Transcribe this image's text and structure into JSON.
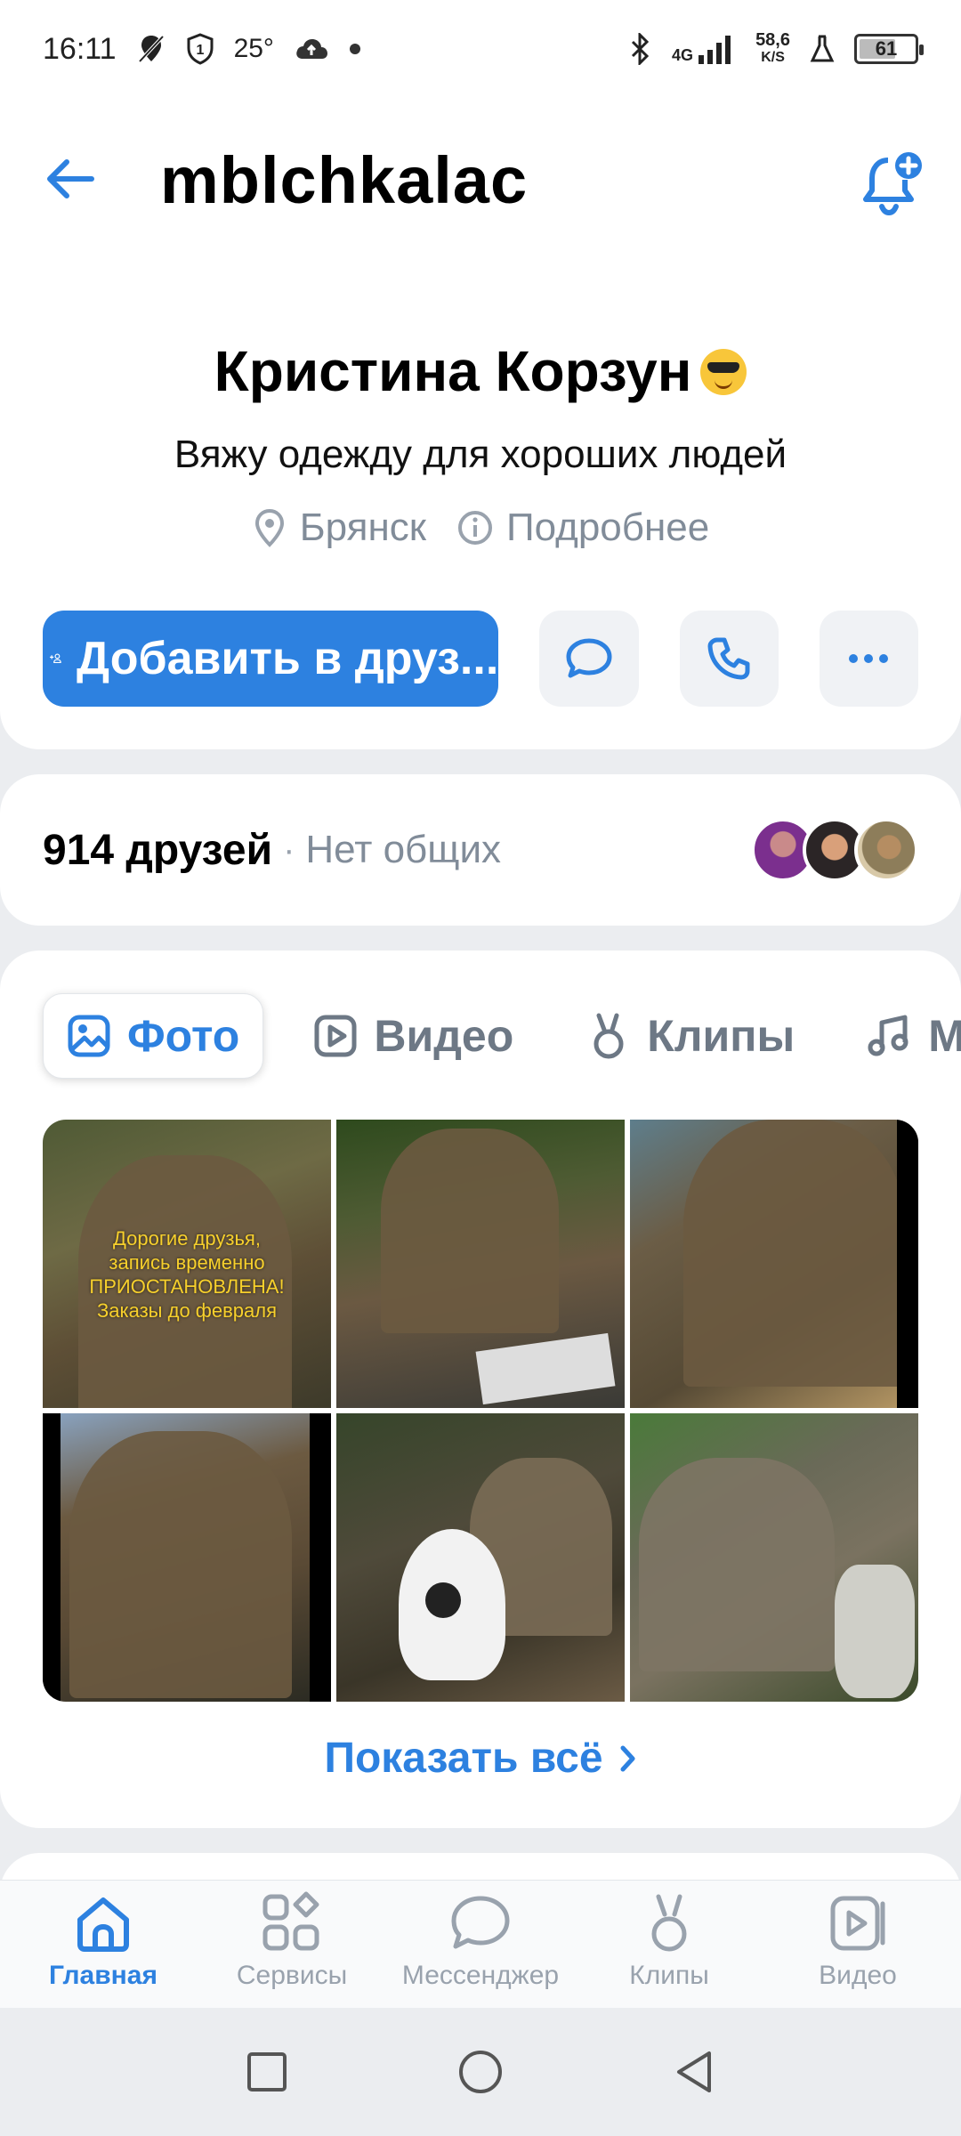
{
  "status_bar": {
    "time": "16:11",
    "temperature": "25°",
    "network_type": "4G",
    "speed_value": "58,6",
    "speed_unit": "K/S",
    "battery": "61"
  },
  "header": {
    "title": "mblchkalac"
  },
  "profile": {
    "name": "Кристина Корзун",
    "status": "Вяжу одежду для хороших людей",
    "city": "Брянск",
    "more_info": "Подробнее",
    "add_friend_label": "Добавить в друз..."
  },
  "friends": {
    "count_label": "914 друзей",
    "separator": "·",
    "mutual_label": "Нет общих"
  },
  "media": {
    "tabs": [
      {
        "label": "Фото",
        "icon": "photo-icon",
        "active": true
      },
      {
        "label": "Видео",
        "icon": "video-icon",
        "active": false
      },
      {
        "label": "Клипы",
        "icon": "clips-icon",
        "active": false
      },
      {
        "label": "М",
        "icon": "music-icon",
        "active": false
      }
    ],
    "photo1_overlay": "Дорогие друзья,\nзапись временно\nПРИОСТАНОВЛЕНА!\nЗаказы до февраля",
    "show_all_label": "Показать всё"
  },
  "bottom_nav": [
    {
      "label": "Главная",
      "icon": "home-icon",
      "active": true
    },
    {
      "label": "Сервисы",
      "icon": "services-icon",
      "active": false
    },
    {
      "label": "Мессенджер",
      "icon": "messenger-icon",
      "active": false
    },
    {
      "label": "Клипы",
      "icon": "clips-icon",
      "active": false
    },
    {
      "label": "Видео",
      "icon": "video-icon",
      "active": false
    }
  ],
  "colors": {
    "accent": "#2d81e0",
    "secondary_text": "#818c99",
    "background": "#ebedf0"
  }
}
